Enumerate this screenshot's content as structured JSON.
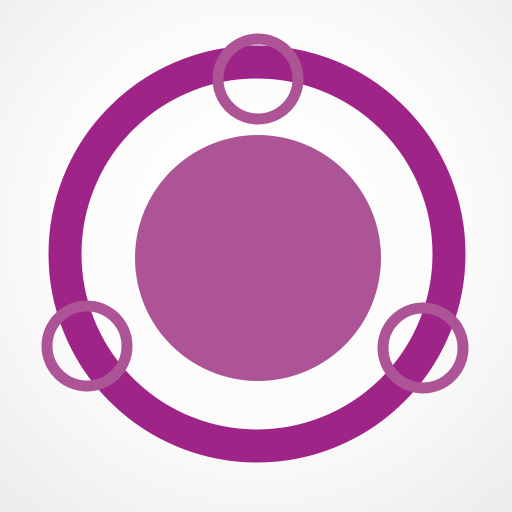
{
  "icon": {
    "name": "orbit-logo-icon",
    "colors": {
      "ring": "#9e2487",
      "core": "#ad5497",
      "satellite": "#ad5497",
      "background": "#f6f6f6"
    }
  }
}
